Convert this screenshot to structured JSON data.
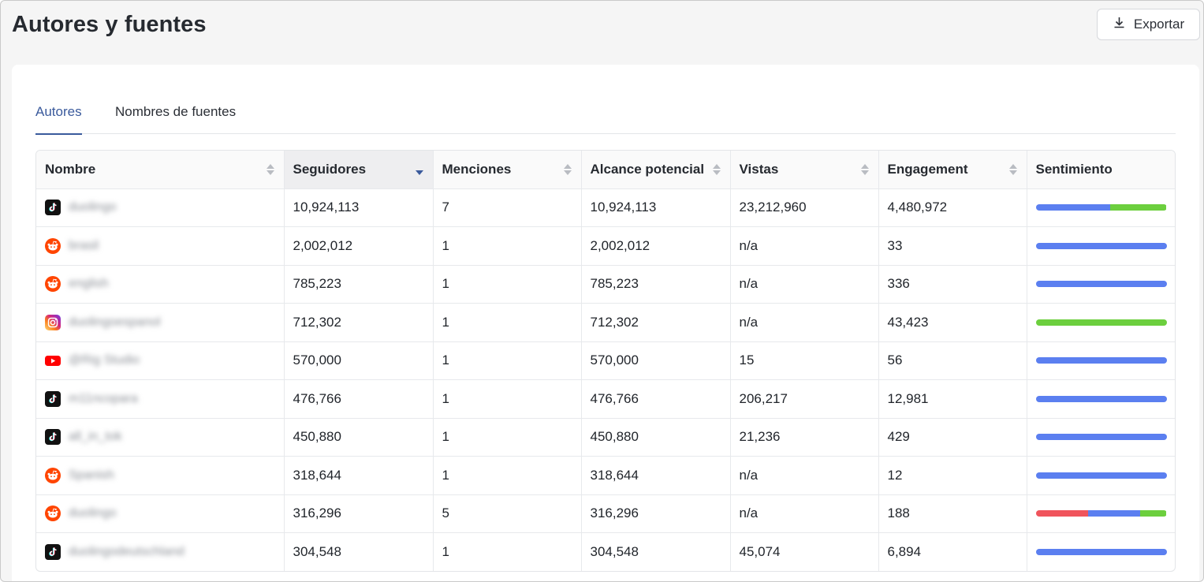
{
  "header": {
    "title": "Autores y fuentes",
    "export_label": "Exportar"
  },
  "tabs": [
    {
      "label": "Autores",
      "active": true
    },
    {
      "label": "Nombres de fuentes",
      "active": false
    }
  ],
  "table": {
    "columns": [
      {
        "label": "Nombre",
        "sortable": true,
        "sorted": false
      },
      {
        "label": "Seguidores",
        "sortable": true,
        "sorted": true,
        "direction": "desc"
      },
      {
        "label": "Menciones",
        "sortable": true,
        "sorted": false
      },
      {
        "label": "Alcance potencial",
        "sortable": true,
        "sorted": false
      },
      {
        "label": "Vistas",
        "sortable": true,
        "sorted": false
      },
      {
        "label": "Engagement",
        "sortable": true,
        "sorted": false
      },
      {
        "label": "Sentimiento",
        "sortable": false,
        "sorted": false
      }
    ],
    "rows": [
      {
        "source": "tiktok",
        "icon": "tiktok-icon",
        "name": "duolingo",
        "seguidores": "10,924,113",
        "menciones": "7",
        "alcance": "10,924,113",
        "vistas": "23,212,960",
        "engagement": "4,480,972",
        "sentiment": {
          "negative": 0,
          "neutral": 0.57,
          "positive": 0.43
        }
      },
      {
        "source": "reddit",
        "icon": "reddit-icon",
        "name": "brasil",
        "seguidores": "2,002,012",
        "menciones": "1",
        "alcance": "2,002,012",
        "vistas": "n/a",
        "engagement": "33",
        "sentiment": {
          "negative": 0,
          "neutral": 1,
          "positive": 0
        }
      },
      {
        "source": "reddit",
        "icon": "reddit-icon",
        "name": "english",
        "seguidores": "785,223",
        "menciones": "1",
        "alcance": "785,223",
        "vistas": "n/a",
        "engagement": "336",
        "sentiment": {
          "negative": 0,
          "neutral": 1,
          "positive": 0
        }
      },
      {
        "source": "instagram",
        "icon": "instagram-icon",
        "name": "duolingoespanol",
        "seguidores": "712,302",
        "menciones": "1",
        "alcance": "712,302",
        "vistas": "n/a",
        "engagement": "43,423",
        "sentiment": {
          "negative": 0,
          "neutral": 0,
          "positive": 1
        }
      },
      {
        "source": "youtube",
        "icon": "youtube-icon",
        "name": "@Rig Studio",
        "seguidores": "570,000",
        "menciones": "1",
        "alcance": "570,000",
        "vistas": "15",
        "engagement": "56",
        "sentiment": {
          "negative": 0,
          "neutral": 1,
          "positive": 0
        }
      },
      {
        "source": "tiktok",
        "icon": "tiktok-icon",
        "name": "m11ncopara",
        "seguidores": "476,766",
        "menciones": "1",
        "alcance": "476,766",
        "vistas": "206,217",
        "engagement": "12,981",
        "sentiment": {
          "negative": 0,
          "neutral": 1,
          "positive": 0
        }
      },
      {
        "source": "tiktok",
        "icon": "tiktok-icon",
        "name": "all_in_tok",
        "seguidores": "450,880",
        "menciones": "1",
        "alcance": "450,880",
        "vistas": "21,236",
        "engagement": "429",
        "sentiment": {
          "negative": 0,
          "neutral": 1,
          "positive": 0
        }
      },
      {
        "source": "reddit",
        "icon": "reddit-icon",
        "name": "Spanish",
        "seguidores": "318,644",
        "menciones": "1",
        "alcance": "318,644",
        "vistas": "n/a",
        "engagement": "12",
        "sentiment": {
          "negative": 0,
          "neutral": 1,
          "positive": 0
        }
      },
      {
        "source": "reddit",
        "icon": "reddit-icon",
        "name": "duolingo",
        "seguidores": "316,296",
        "menciones": "5",
        "alcance": "316,296",
        "vistas": "n/a",
        "engagement": "188",
        "sentiment": {
          "negative": 0.4,
          "neutral": 0.4,
          "positive": 0.2
        }
      },
      {
        "source": "tiktok",
        "icon": "tiktok-icon",
        "name": "duolingodeutschland",
        "seguidores": "304,548",
        "menciones": "1",
        "alcance": "304,548",
        "vistas": "45,074",
        "engagement": "6,894",
        "sentiment": {
          "negative": 0,
          "neutral": 1,
          "positive": 0
        }
      }
    ]
  },
  "colors": {
    "sentiment_negative": "#f0545c",
    "sentiment_neutral": "#5b7ff0",
    "sentiment_positive": "#6ccf3e",
    "accent": "#3a5a9c"
  }
}
